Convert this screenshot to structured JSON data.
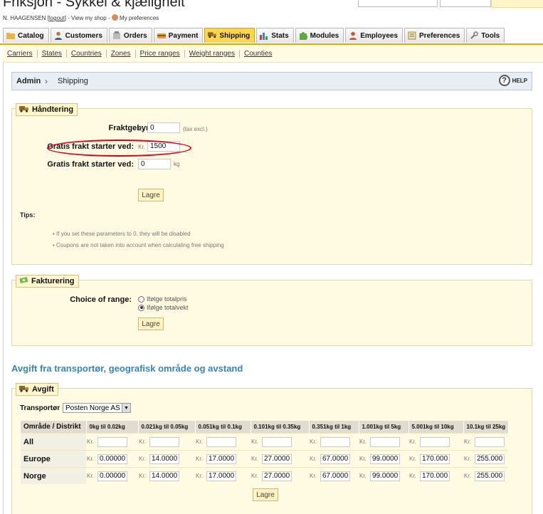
{
  "header": {
    "shop_title": "Friksjon - Sykkel & kjæligheit",
    "user_name": "N. HAAGENSEN [",
    "logout": "logout",
    "user_sep": "] - ",
    "view_shop": "View my shop",
    "user_sep2": " - ",
    "preferences": "My preferences"
  },
  "tabs": [
    {
      "label": "Catalog",
      "icon": "folder-icon"
    },
    {
      "label": "Customers",
      "icon": "customers-icon"
    },
    {
      "label": "Orders",
      "icon": "orders-icon"
    },
    {
      "label": "Payment",
      "icon": "payment-icon"
    },
    {
      "label": "Shipping",
      "icon": "truck-icon",
      "active": true
    },
    {
      "label": "Stats",
      "icon": "stats-icon"
    },
    {
      "label": "Modules",
      "icon": "puzzle-icon"
    },
    {
      "label": "Employees",
      "icon": "employees-icon"
    },
    {
      "label": "Preferences",
      "icon": "preferences-icon"
    },
    {
      "label": "Tools",
      "icon": "wrench-icon"
    }
  ],
  "subnav": [
    "Carriers",
    "States",
    "Countries",
    "Zones",
    "Price ranges",
    "Weight ranges",
    "Counties"
  ],
  "breadcrumb": {
    "root": "Admin",
    "sep": "›",
    "current": "Shipping",
    "help": "HELP"
  },
  "handling": {
    "legend": "Håndtering",
    "fee_label": "Fraktgebyr:",
    "currency": "Kr.",
    "fee_value": "0",
    "fee_note": "(tax excl.)",
    "free_price_label": "Gratis frakt starter ved:",
    "free_price_value": "1500",
    "free_weight_label": "Gratis frakt starter ved:",
    "free_weight_value": "0",
    "weight_unit": "kg",
    "save": "Lagre",
    "tips_title": "Tips:",
    "tips": [
      "If you set these parameters to 0, they will be disabled",
      "Coupons are not taken into account when calculating free shipping"
    ]
  },
  "billing": {
    "legend": "Fakturering",
    "label": "Choice of range:",
    "options": [
      {
        "label": "Ifølge totalpris",
        "checked": false
      },
      {
        "label": "Ifølge totalvekt",
        "checked": true
      }
    ],
    "save": "Lagre"
  },
  "section_title": "Avgift fra transportør, geografisk område og avstand",
  "fees": {
    "legend": "Avgift",
    "carrier_label": "Transportør",
    "carrier_value": "Posten Norge AS",
    "currency": "Kr.",
    "columns": [
      "Område / Distrikt",
      "0kg til 0.02kg",
      "0.021kg til 0.05kg",
      "0.051kg til 0.1kg",
      "0.101kg til 0.35kg",
      "0.351kg til 1kg",
      "1.001kg til 5kg",
      "5.001kg til 10kg",
      "10.1kg til 25kg"
    ],
    "rows": [
      {
        "zone": "All",
        "values": [
          "",
          "",
          "",
          "",
          "",
          "",
          "",
          ""
        ]
      },
      {
        "zone": "Europe",
        "values": [
          "0.00000",
          "14.0000",
          "17.0000",
          "27.0000",
          "67.0000",
          "99.0000",
          "170.000",
          "255.000"
        ]
      },
      {
        "zone": "Norge",
        "values": [
          "0.00000",
          "14.0000",
          "17.0000",
          "27.0000",
          "67.0000",
          "99.0000",
          "170.000",
          "255.000"
        ]
      }
    ],
    "save": "Lagre"
  },
  "colors": {
    "active_tab": "#ffd64a",
    "panel_bg": "#fffbe2",
    "section_title": "#3b83b8",
    "highlight": "#d1001c"
  }
}
